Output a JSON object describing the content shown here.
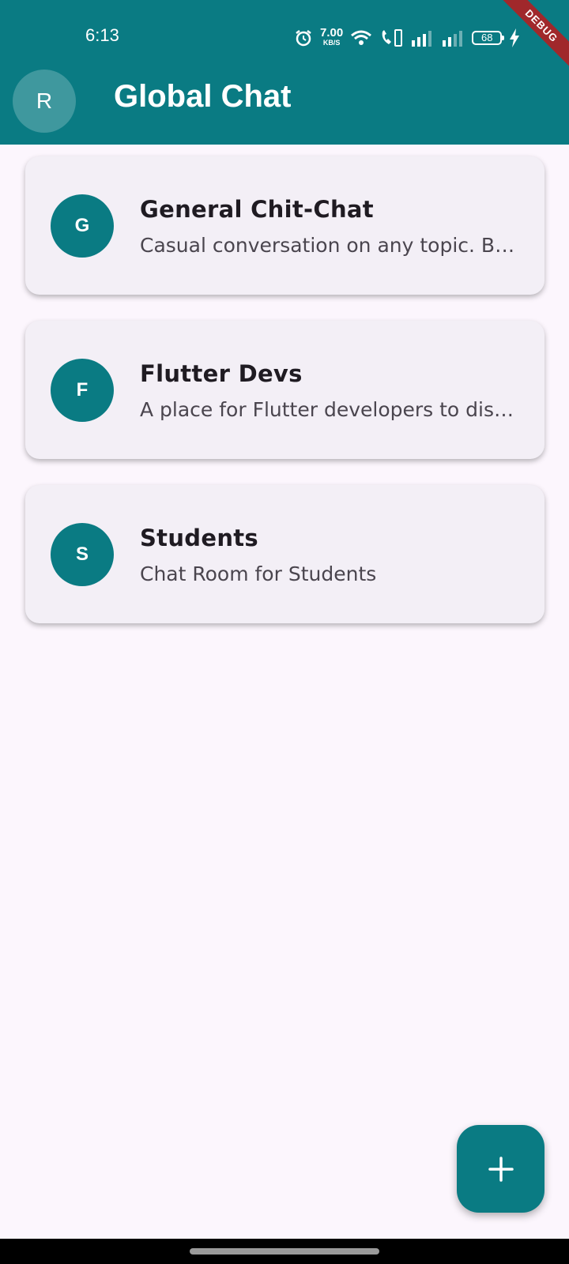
{
  "status_bar": {
    "time": "6:13",
    "net_speed_value": "7.00",
    "net_speed_unit": "KB/S",
    "battery_level": "68"
  },
  "debug_banner": "DEBUG",
  "app_bar": {
    "avatar_initial": "R",
    "title": "Global Chat"
  },
  "rooms": [
    {
      "initial": "G",
      "name": "General Chit-Chat",
      "description": "Casual conversation on any topic. B…"
    },
    {
      "initial": "F",
      "name": "Flutter Devs",
      "description": "A place for Flutter developers to dis…"
    },
    {
      "initial": "S",
      "name": "Students",
      "description": "Chat Room for Students"
    }
  ],
  "fab": {
    "icon": "plus-icon"
  },
  "colors": {
    "primary": "#0a7b83",
    "background": "#fcf6fd",
    "card": "#f3eff6",
    "debug": "#a0282b"
  }
}
